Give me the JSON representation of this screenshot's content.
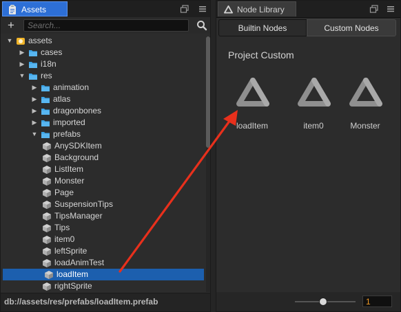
{
  "assets_panel": {
    "tab_label": "Assets",
    "search_placeholder": "Search...",
    "status_path": "db://assets/res/prefabs/loadItem.prefab",
    "tree": [
      {
        "label": "assets",
        "depth": 0,
        "kind": "root",
        "expanded": true
      },
      {
        "label": "cases",
        "depth": 1,
        "kind": "folder",
        "expanded": false
      },
      {
        "label": "i18n",
        "depth": 1,
        "kind": "folder",
        "expanded": false
      },
      {
        "label": "res",
        "depth": 1,
        "kind": "folder",
        "expanded": true
      },
      {
        "label": "animation",
        "depth": 2,
        "kind": "folder",
        "expanded": false
      },
      {
        "label": "atlas",
        "depth": 2,
        "kind": "folder",
        "expanded": false
      },
      {
        "label": "dragonbones",
        "depth": 2,
        "kind": "folder",
        "expanded": false
      },
      {
        "label": "imported",
        "depth": 2,
        "kind": "folder",
        "expanded": false
      },
      {
        "label": "prefabs",
        "depth": 2,
        "kind": "folder",
        "expanded": true
      },
      {
        "label": "AnySDKItem",
        "depth": 3,
        "kind": "prefab"
      },
      {
        "label": "Background",
        "depth": 3,
        "kind": "prefab"
      },
      {
        "label": "ListItem",
        "depth": 3,
        "kind": "prefab"
      },
      {
        "label": "Monster",
        "depth": 3,
        "kind": "prefab"
      },
      {
        "label": "Page",
        "depth": 3,
        "kind": "prefab"
      },
      {
        "label": "SuspensionTips",
        "depth": 3,
        "kind": "prefab"
      },
      {
        "label": "TipsManager",
        "depth": 3,
        "kind": "prefab"
      },
      {
        "label": "Tips",
        "depth": 3,
        "kind": "prefab"
      },
      {
        "label": "item0",
        "depth": 3,
        "kind": "prefab"
      },
      {
        "label": "leftSprite",
        "depth": 3,
        "kind": "prefab"
      },
      {
        "label": "loadAnimTest",
        "depth": 3,
        "kind": "prefab"
      },
      {
        "label": "loadItem",
        "depth": 3,
        "kind": "prefab",
        "selected": true
      },
      {
        "label": "rightSprite",
        "depth": 3,
        "kind": "prefab"
      }
    ]
  },
  "node_library": {
    "tab_label": "Node Library",
    "builtin_tab": "Builtin Nodes",
    "custom_tab": "Custom Nodes",
    "active_tab": "Custom Nodes",
    "section_title": "Project Custom",
    "items": [
      "loadItem",
      "item0",
      "Monster"
    ],
    "zoom_value": "1",
    "zoom_level": 0.45
  },
  "colors": {
    "accent": "#2d6fd6",
    "selection": "#1c5fae",
    "folder": "#3aa3e6",
    "annotation_arrow": "#e8301c",
    "zoom_text": "#f19b27"
  },
  "icons": {
    "assets_tab": "clipboard-icon",
    "node_library_tab": "triangle-logo-icon",
    "add": "plus-icon",
    "search": "search-icon",
    "folder": "folder-icon",
    "prefab": "cube-icon",
    "node": "triangle-node-icon"
  }
}
